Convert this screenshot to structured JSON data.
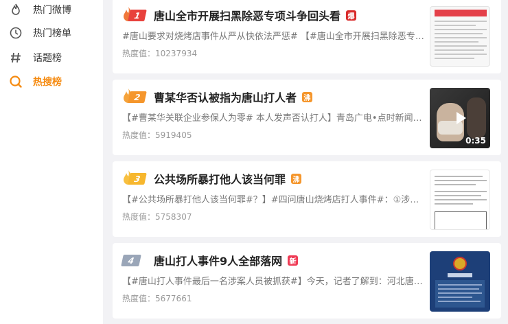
{
  "sidebar": {
    "items": [
      {
        "label": "热门微博",
        "icon": "flame-icon"
      },
      {
        "label": "热门榜单",
        "icon": "clock-icon"
      },
      {
        "label": "话题榜",
        "icon": "hashtag-icon"
      },
      {
        "label": "热搜榜",
        "icon": "search-icon",
        "active": true
      }
    ]
  },
  "colors": {
    "accent": "#f58a10",
    "rank1": "#e8413c",
    "rank2": "#f5962c",
    "rank3": "#f7b72e",
    "rank4": "#9aa6b8",
    "badge_bao": "#d92b2b",
    "badge_fei": "#f5962c",
    "badge_xin": "#ef3b55"
  },
  "hot_list": [
    {
      "rank": "1",
      "title": "唐山全市开展扫黑除恶专项斗争回头看",
      "badge": "爆",
      "summary": "#唐山要求对烧烤店事件从严从快依法严惩# 【#唐山全市开展扫黑除恶专项斗...",
      "heat_label": "热度值：",
      "heat_value": "10237934"
    },
    {
      "rank": "2",
      "title": "曹某华否认被指为唐山打人者",
      "badge": "沸",
      "summary": "【#曹某华关联企业参保人为零# 本人发声否认打人】青岛广电•点时新闻出品...",
      "heat_label": "热度值：",
      "heat_value": "5919405",
      "video_duration": "0:35"
    },
    {
      "rank": "3",
      "title": "公共场所暴打他人该当何罪",
      "badge": "沸",
      "summary": "【#公共场所暴打他人该当何罪#？】#四问唐山烧烤店打人事件#：①涉嫌哪...",
      "heat_label": "热度值：",
      "heat_value": "5758307"
    },
    {
      "rank": "4",
      "title": "唐山打人事件9人全部落网",
      "badge": "新",
      "summary": "【#唐山打人事件最后一名涉案人员被抓获#】今天，记者了解到：河北唐山...",
      "heat_label": "热度值：",
      "heat_value": "5677661"
    }
  ]
}
